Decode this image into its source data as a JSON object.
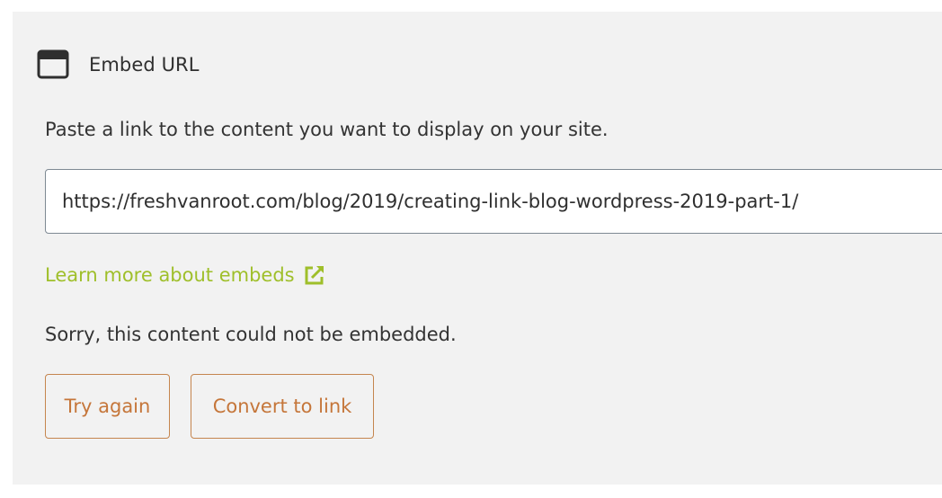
{
  "block": {
    "title": "Embed URL",
    "icon": "browser-window-icon",
    "instructions": "Paste a link to the content you want to display on your site.",
    "url_value": "https://freshvanroot.com/blog/2019/creating-link-blog-wordpress-2019-part-1/",
    "learn_more": "Learn more about embeds",
    "learn_more_icon": "external-link-icon",
    "error_message": "Sorry, this content could not be embedded.",
    "try_again_label": "Try again",
    "convert_label": "Convert to link"
  },
  "colors": {
    "panel_bg": "#f2f2f2",
    "link_green": "#9fbf2a",
    "button_accent": "#c5763a",
    "text": "#333333"
  }
}
